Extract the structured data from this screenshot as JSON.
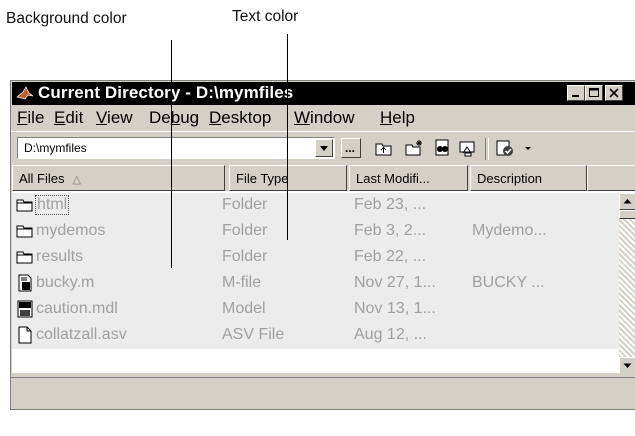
{
  "annotations": {
    "background_color_label": "Background color",
    "text_color_label": "Text color"
  },
  "window": {
    "title": "Current Directory - D:\\mymfiles",
    "title_buttons": [
      "minimize-icon",
      "maximize-icon",
      "close-icon"
    ]
  },
  "menu": [
    {
      "label": "File",
      "u": "F",
      "rest": "ile"
    },
    {
      "label": "Edit",
      "u": "E",
      "rest": "dit"
    },
    {
      "label": "View",
      "u": "V",
      "rest": "iew"
    },
    {
      "label": "Debug",
      "pre": "De",
      "u": "b",
      "rest": "ug"
    },
    {
      "label": "Desktop",
      "u": "D",
      "rest": "esktop"
    },
    {
      "label": "Window",
      "u": "W",
      "rest": "indow"
    },
    {
      "label": "Help",
      "u": "H",
      "rest": "elp"
    }
  ],
  "toolbar": {
    "path_value": "D:\\mymfiles",
    "browse_label": "...",
    "tools": [
      "up-folder-icon",
      "new-folder-icon",
      "find-files-icon",
      "visual-directory-icon",
      "reports-icon"
    ]
  },
  "columns": [
    "All Files",
    "File Type",
    "Last Modifi...",
    "Description"
  ],
  "sort_indicator": "△",
  "files": [
    {
      "name": "html",
      "type": "Folder",
      "date": "Feb 23, ...",
      "desc": "",
      "icon": "folder-icon"
    },
    {
      "name": "mydemos",
      "type": "Folder",
      "date": "Feb 3, 2...",
      "desc": "Mydemo...",
      "icon": "folder-icon"
    },
    {
      "name": "results",
      "type": "Folder",
      "date": "Feb 22, ...",
      "desc": "",
      "icon": "folder-icon"
    },
    {
      "name": "bucky.m",
      "type": "M-file",
      "date": "Nov 27, 1...",
      "desc": "BUCKY  ...",
      "icon": "m-file-icon"
    },
    {
      "name": "caution.mdl",
      "type": "Model",
      "date": "Nov 13, 1...",
      "desc": "",
      "icon": "model-file-icon"
    },
    {
      "name": "collatzall.asv",
      "type": "ASV File",
      "date": "Aug 12, ...",
      "desc": "",
      "icon": "generic-file-icon"
    }
  ],
  "colors": {
    "title_bar": "#000000",
    "chrome": "#d4d0c8",
    "list_background": "#ececec",
    "list_text": "#a0a0a0"
  }
}
